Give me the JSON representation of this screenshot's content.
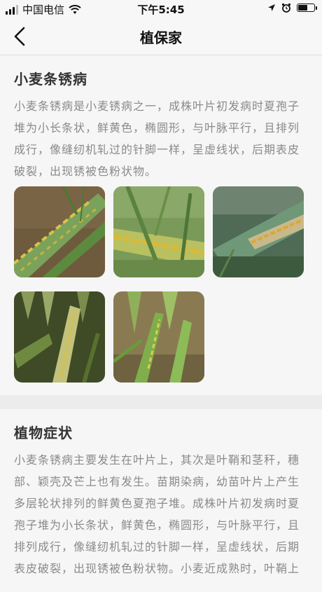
{
  "status_bar": {
    "carrier": "中国电信",
    "time": "下午5:45",
    "battery_level": 0.55
  },
  "nav": {
    "title": "植保家",
    "back_icon": "chevron-left-icon"
  },
  "sections": [
    {
      "title": "小麦条锈病",
      "text": "小麦条锈病是小麦锈病之一，成株叶片初发病时夏孢子堆为小长条状，鲜黄色，椭圆形，与叶脉平行，且排列成行，像缝纫机轧过的针脚一样，呈虚线状，后期表皮破裂，出现锈被色粉状物。",
      "images": [
        "wheat-leaf-yellow-stripes",
        "wheat-leaf-closeup",
        "wheat-leaf-lesion-closeup",
        "wheat-field-infected",
        "wheat-plant-infected"
      ]
    },
    {
      "title": "植物症状",
      "text": "小麦条锈病主要发生在叶片上，其次是叶鞘和茎秆，穗部、颖壳及芒上也有发生。苗期染病，幼苗叶片上产生多层轮状排列的鲜黄色夏孢子堆。成株叶片初发病时夏孢子堆为小长条状，鲜黄色，椭圆形，与叶脉平行，且排列成行，像缝纫机轧过的针脚一样，呈虚线状，后期表皮破裂，出现锈被色粉状物。小麦近成熟时，叶鞘上"
    }
  ]
}
